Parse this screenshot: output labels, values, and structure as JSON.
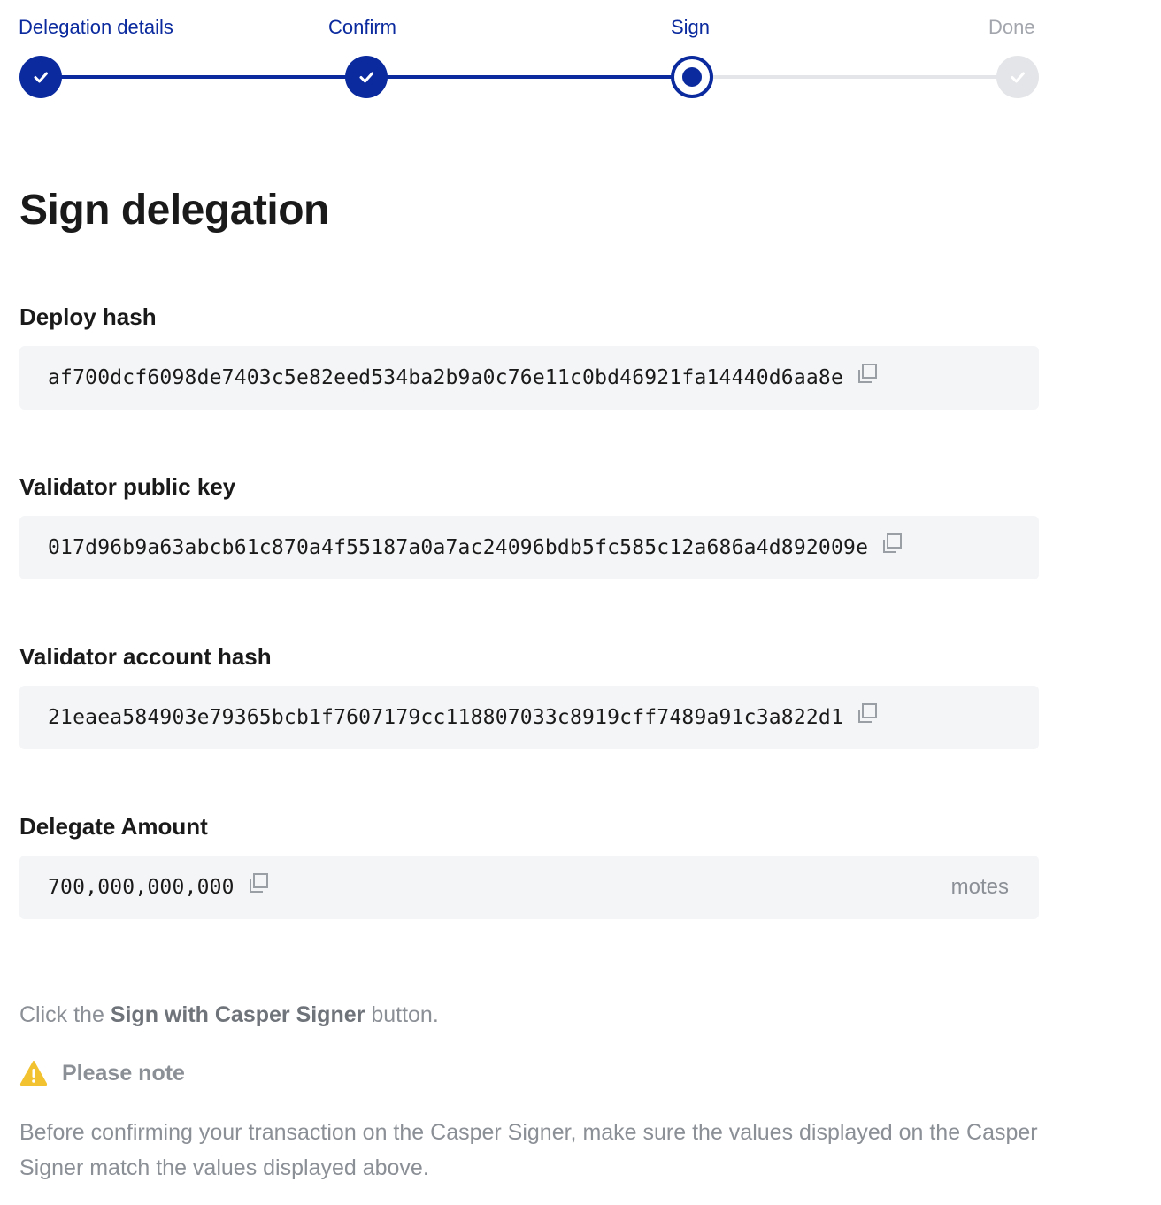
{
  "stepper": {
    "steps": [
      {
        "label": "Delegation details",
        "state": "complete"
      },
      {
        "label": "Confirm",
        "state": "complete"
      },
      {
        "label": "Sign",
        "state": "current"
      },
      {
        "label": "Done",
        "state": "pending"
      }
    ]
  },
  "page": {
    "title": "Sign delegation"
  },
  "fields": {
    "deploy_hash": {
      "label": "Deploy hash",
      "value": "af700dcf6098de7403c5e82eed534ba2b9a0c76e11c0bd46921fa14440d6aa8e"
    },
    "validator_public_key": {
      "label": "Validator public key",
      "value": "017d96b9a63abcb61c870a4f55187a0a7ac24096bdb5fc585c12a686a4d892009e"
    },
    "validator_account_hash": {
      "label": "Validator account hash",
      "value": "21eaea584903e79365bcb1f7607179cc118807033c8919cff7489a91c3a822d1"
    },
    "delegate_amount": {
      "label": "Delegate Amount",
      "value": "700,000,000,000",
      "unit": "motes"
    }
  },
  "instructions": {
    "prefix": "Click the ",
    "button_name": "Sign with Casper Signer",
    "suffix": " button."
  },
  "note": {
    "title": "Please note",
    "body": "Before confirming your transaction on the Casper Signer, make sure the values displayed on the Casper Signer match the values displayed above."
  },
  "colors": {
    "accent": "#0a2a9e",
    "muted": "#8b8f96",
    "warning": "#f2c230",
    "field_bg": "#f4f5f7"
  },
  "icons": {
    "check": "check-icon",
    "copy": "copy-icon",
    "warning": "warning-icon"
  }
}
